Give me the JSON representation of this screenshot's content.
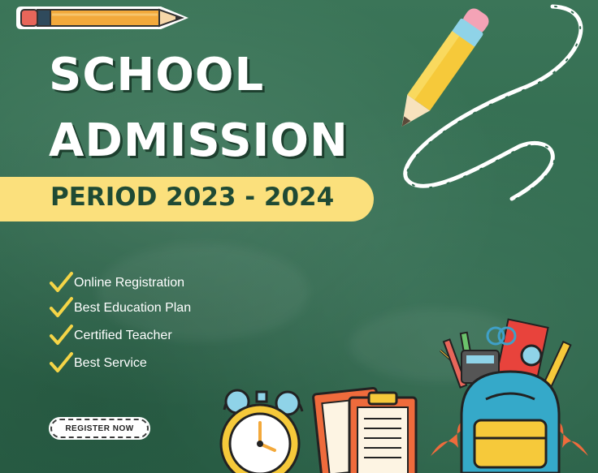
{
  "title": {
    "line1": "SCHOOL",
    "line2": "ADMISSION"
  },
  "period": "PERIOD 2023 - 2024",
  "features": [
    "Online Registration",
    "Best Education Plan",
    "Certified Teacher",
    "Best Service"
  ],
  "cta_label": "REGISTER NOW",
  "icons": [
    "pencil-icon",
    "crayon-pencil-icon",
    "alarm-clock-icon",
    "clipboard-icon",
    "backpack-icon",
    "check-icon"
  ],
  "colors": {
    "board": "#2f6a4e",
    "banner": "#fbe07c",
    "banner_text": "#1f4a34",
    "check": "#f5d547",
    "text": "#ffffff"
  }
}
